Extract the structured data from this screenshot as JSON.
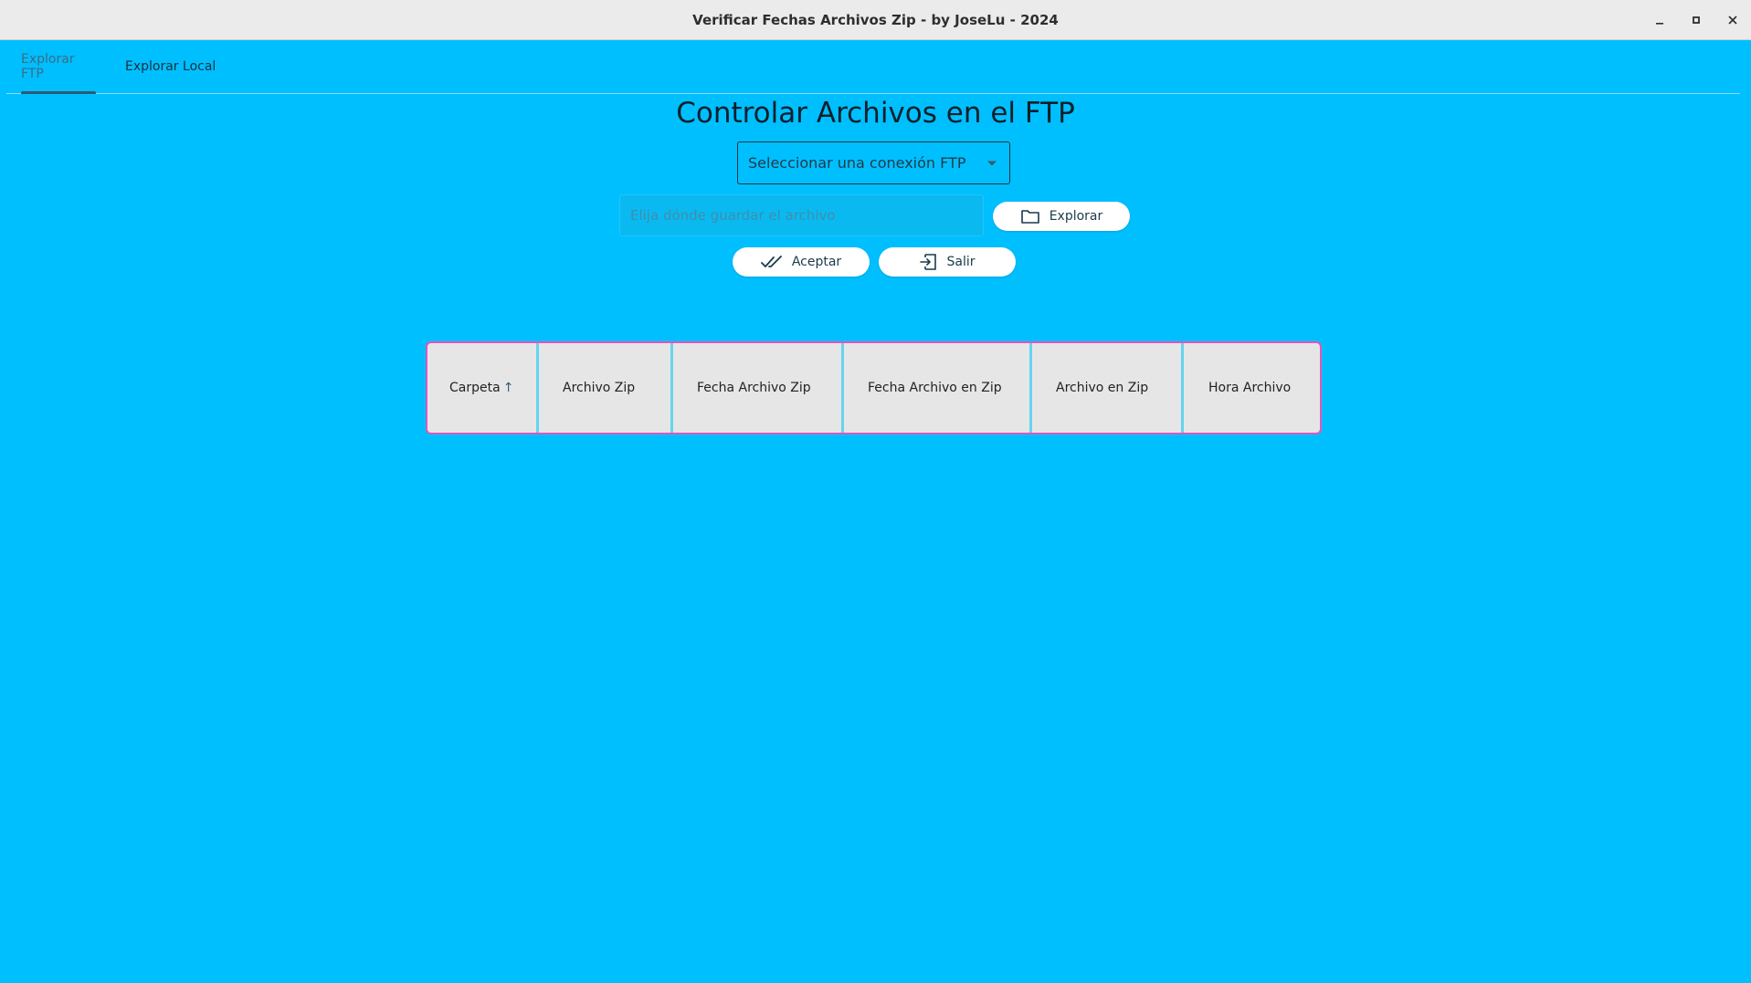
{
  "window": {
    "title": "Verificar Fechas Archivos Zip - by JoseLu - 2024",
    "controls": [
      "minimize-icon",
      "maximize-icon",
      "close-icon"
    ]
  },
  "tabs": [
    {
      "label": "Explorar FTP",
      "active": true
    },
    {
      "label": "Explorar Local",
      "active": false
    }
  ],
  "main": {
    "heading": "Controlar Archivos en el FTP",
    "ftp_select": {
      "placeholder": "Seleccionar una conexión FTP",
      "icon": "caret-down-icon"
    },
    "save_path": {
      "value": "",
      "placeholder": "Elija dónde guardar el archivo"
    },
    "buttons": {
      "explore": {
        "label": "Explorar",
        "icon": "folder-icon"
      },
      "accept": {
        "label": "Aceptar",
        "icon": "double-check-icon"
      },
      "exit": {
        "label": "Salir",
        "icon": "exit-icon"
      }
    }
  },
  "table": {
    "columns": [
      "Carpeta",
      "Archivo Zip",
      "Fecha Archivo Zip",
      "Fecha Archivo en Zip",
      "Archivo en Zip",
      "Hora Archivo"
    ],
    "sorted_column": "Carpeta",
    "sort_direction": "ascending",
    "sort_icon": "arrow-up-icon",
    "rows": []
  },
  "colors": {
    "background": "#00bfff",
    "titlebar": "#ebebeb",
    "table_border": "#e255c0",
    "column_divider": "#66d4ef",
    "table_header_bg": "#e6e6e6",
    "button_bg": "#ffffff"
  }
}
